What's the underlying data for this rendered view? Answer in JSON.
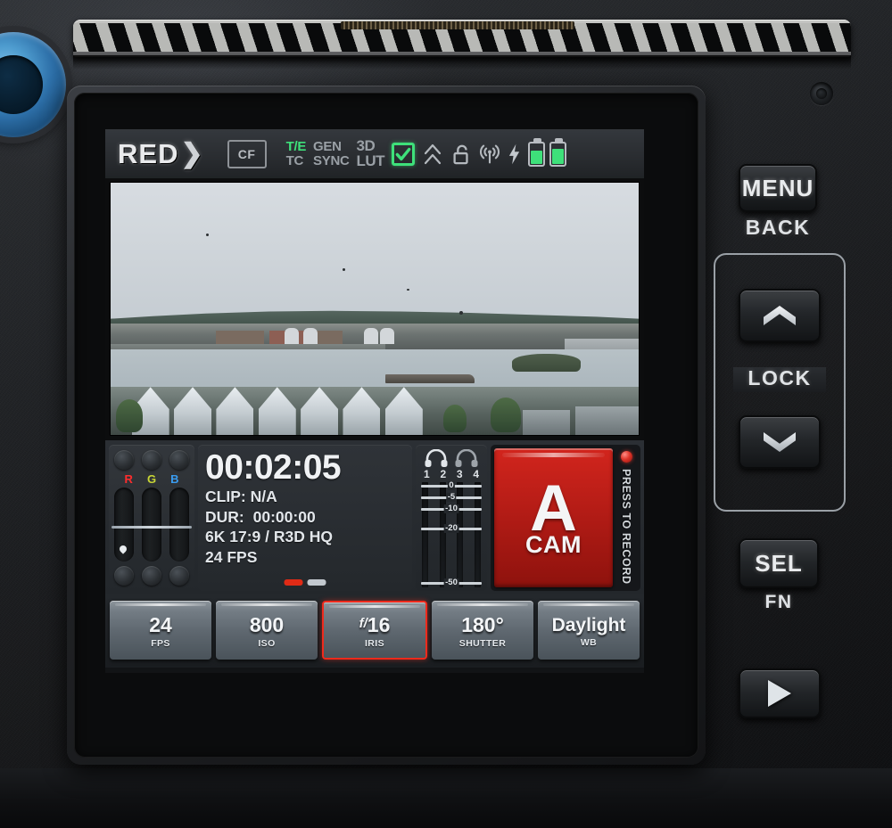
{
  "device": {
    "brand": "RED",
    "brand_chevron": "❯"
  },
  "status_bar": {
    "media_slot": "CF",
    "timecode_source": {
      "top": "T/E",
      "bottom": "TC",
      "top_color": "#3ee07a"
    },
    "genlock": {
      "top": "GEN",
      "bottom": "SYNC"
    },
    "lut": {
      "top": "3D",
      "bottom": "LUT"
    },
    "icons": [
      {
        "name": "checkbox-checked-icon",
        "state": "on",
        "color": "#3ee07a"
      },
      {
        "name": "double-chevron-up-icon",
        "state": "on"
      },
      {
        "name": "padlock-unlocked-icon",
        "state": "unlocked"
      },
      {
        "name": "wireless-antenna-icon",
        "state": "on"
      },
      {
        "name": "lightning-bolt-icon",
        "state": "on"
      }
    ],
    "batteries": [
      {
        "name": "battery-1",
        "level_pct": 62,
        "color": "#3ee07a"
      },
      {
        "name": "battery-2",
        "level_pct": 70,
        "color": "#3ee07a"
      }
    ]
  },
  "preview": {
    "scene_description": "Overcast harbor waterfront with industrial port, river, barge and marina tents"
  },
  "rgb_module": {
    "channels": [
      {
        "label": "R",
        "color": "#ff2d2d"
      },
      {
        "label": "G",
        "color": "#c9d635"
      },
      {
        "label": "B",
        "color": "#3a9cf0"
      }
    ]
  },
  "clip_info": {
    "timecode": "00:02:05",
    "clip_label": "CLIP:",
    "clip_value": "N/A",
    "duration_label": "DUR:",
    "duration_value": "00:00:00",
    "format": "6K 17:9 / R3D HQ",
    "framerate": "24 FPS",
    "indicators": [
      {
        "name": "rec-indicator-red",
        "state": "on",
        "color": "#e02b16"
      },
      {
        "name": "rec-indicator-white",
        "state": "off",
        "color": "#c2c8ce"
      }
    ]
  },
  "audio": {
    "headphone_icons": [
      "headphone-icon-a",
      "headphone-icon-b"
    ],
    "channel_numbers": [
      "1",
      "2",
      "3",
      "4"
    ],
    "scale_marks": [
      "0",
      "-5",
      "-10",
      "-20",
      "-50"
    ]
  },
  "record": {
    "camera_letter": "A",
    "camera_label": "CAM",
    "hint": "PRESS TO RECORD",
    "led": {
      "name": "record-led",
      "state": "idle",
      "color": "#e0352a"
    },
    "accent_color": "#b41c16"
  },
  "settings": [
    {
      "name": "fps",
      "value": "24",
      "label": "FPS",
      "selected": false
    },
    {
      "name": "iso",
      "value": "800",
      "label": "ISO",
      "selected": false
    },
    {
      "name": "iris",
      "value": "16",
      "prefix": "f/",
      "label": "IRIS",
      "selected": true
    },
    {
      "name": "shutter",
      "value": "180°",
      "label": "SHUTTER",
      "selected": false
    },
    {
      "name": "wb",
      "value": "Daylight",
      "label": "WB",
      "selected": false
    }
  ],
  "hardware_buttons": {
    "menu": "MENU",
    "back": "BACK",
    "lock": "LOCK",
    "sel": "SEL",
    "fn": "FN",
    "up_icon": "chevron-up-icon",
    "down_icon": "chevron-down-icon",
    "play_icon": "play-triangle-icon"
  },
  "colors": {
    "selected_border": "#ef2a1c",
    "status_green": "#3ee07a",
    "record_red": "#b41c16"
  }
}
